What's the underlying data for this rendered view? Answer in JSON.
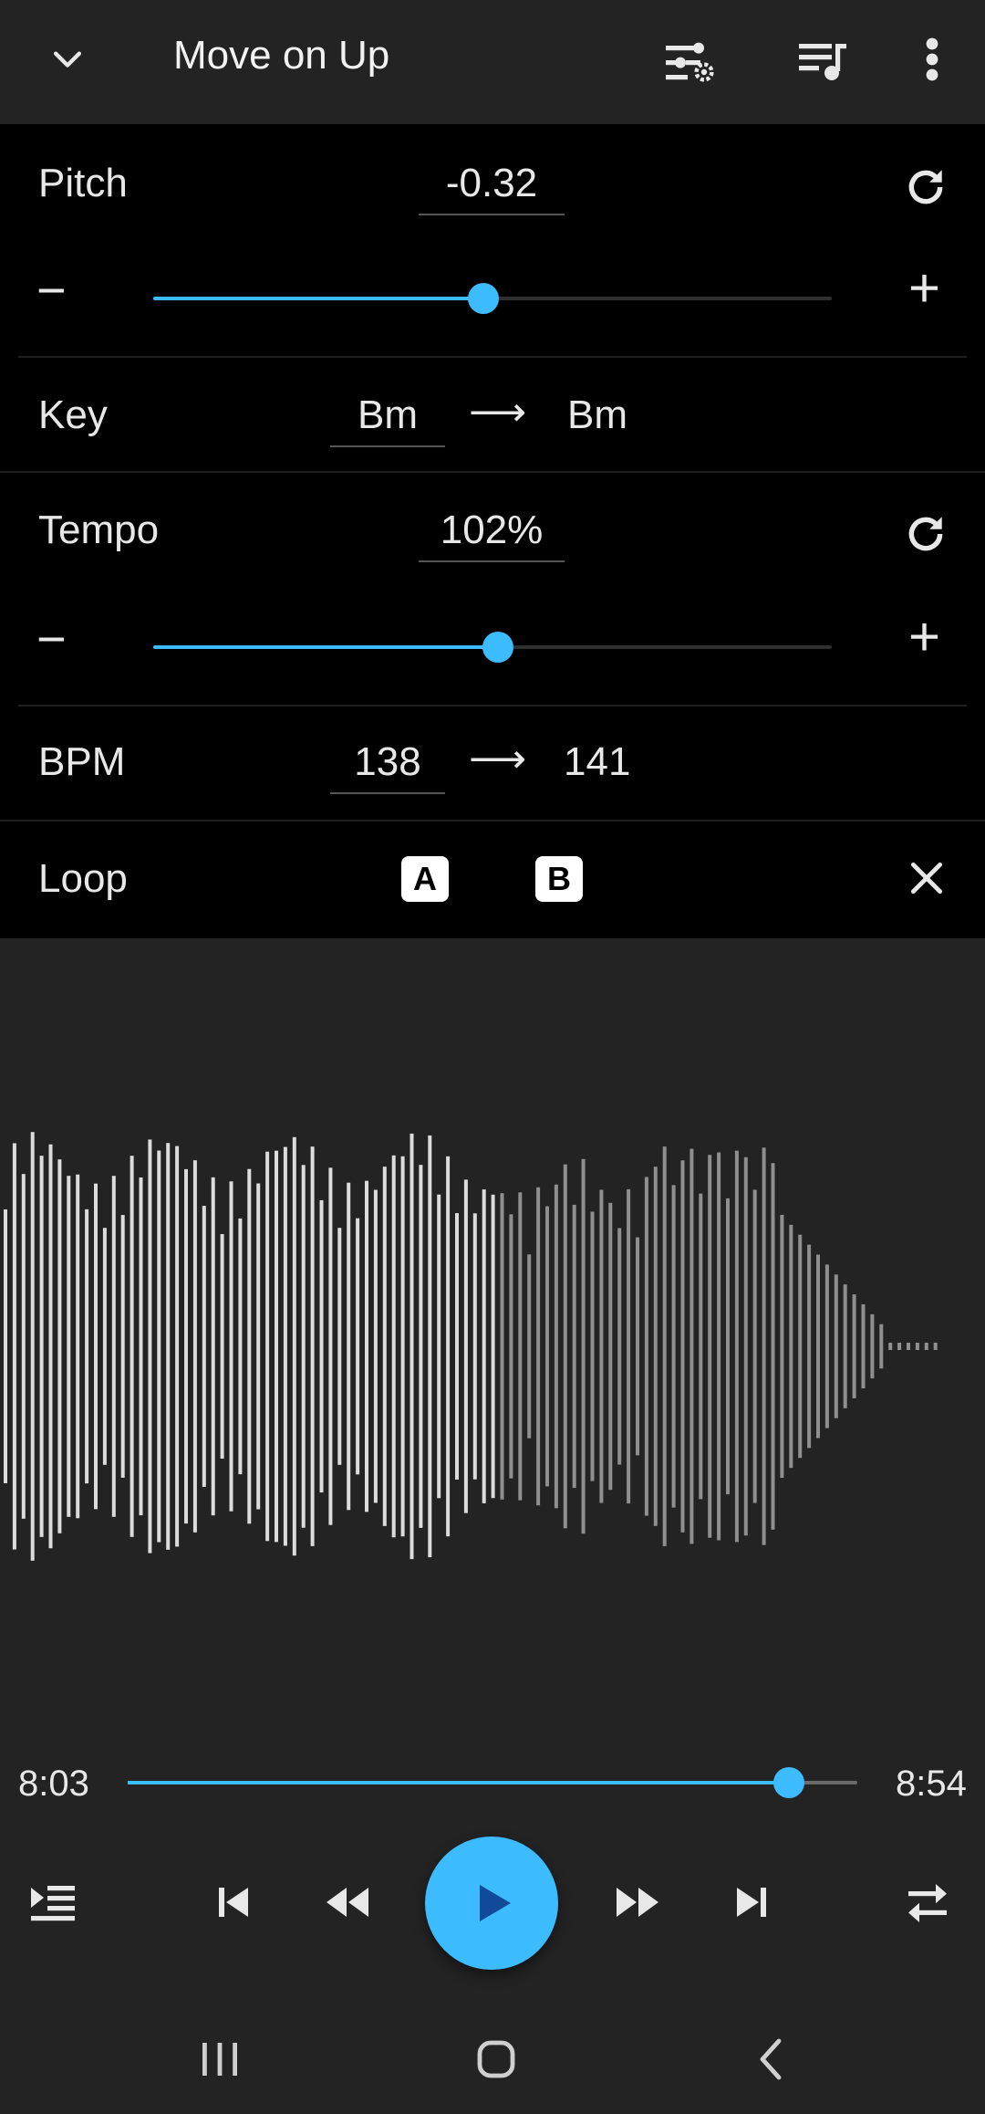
{
  "header": {
    "title": "Move on Up",
    "icons": [
      "chevron-down-icon",
      "equalizer-settings-icon",
      "playlist-icon",
      "more-vert-icon"
    ]
  },
  "pitch": {
    "label": "Pitch",
    "value": "-0.32",
    "slider_fraction": 0.486
  },
  "key": {
    "label": "Key",
    "from": "Bm",
    "arrow": "⟶",
    "to": "Bm"
  },
  "tempo": {
    "label": "Tempo",
    "value": "102%",
    "slider_fraction": 0.508
  },
  "bpm": {
    "label": "BPM",
    "from": "138",
    "arrow": "⟶",
    "to": "141"
  },
  "loop": {
    "label": "Loop",
    "a_label": "A",
    "b_label": "B"
  },
  "controls": {
    "minus": "−",
    "plus": "+"
  },
  "seek": {
    "elapsed": "8:03",
    "total": "8:54",
    "progress_fraction": 0.906
  },
  "colors": {
    "accent": "#3cbcff",
    "panel_bg": "#000000",
    "app_bg": "#232323"
  }
}
